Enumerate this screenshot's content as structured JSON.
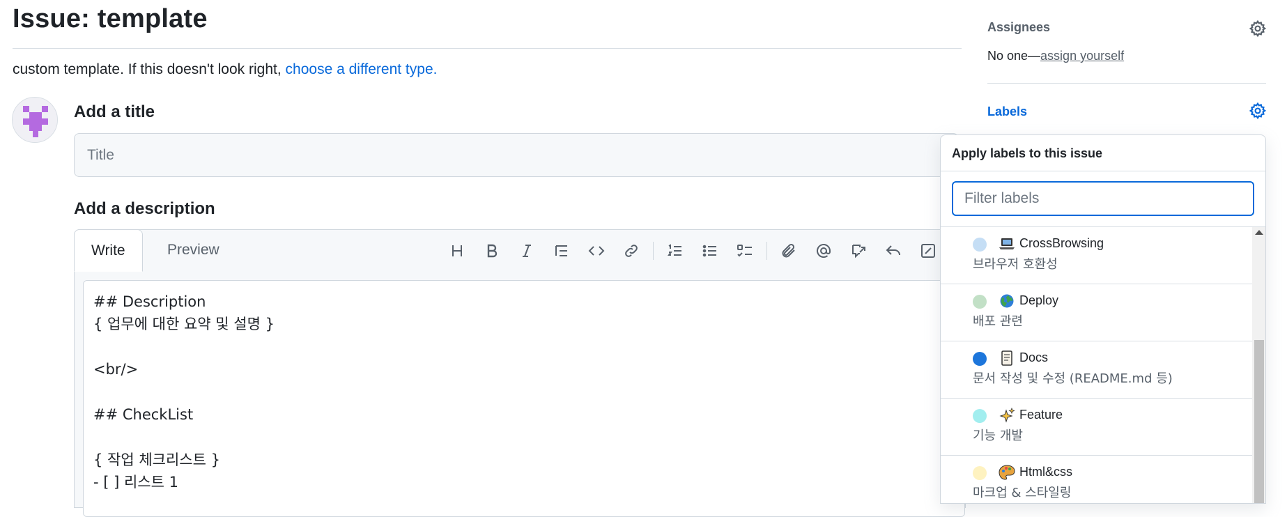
{
  "page": {
    "title": "Issue: template",
    "template_note_prefix": "custom template. If this doesn't look right, ",
    "template_note_link": "choose a different type."
  },
  "form": {
    "title_label": "Add a title",
    "title_placeholder": "Title",
    "description_label": "Add a description",
    "tabs": [
      {
        "label": "Write",
        "active": true
      },
      {
        "label": "Preview",
        "active": false
      }
    ],
    "toolbar_icons": [
      "heading-icon",
      "bold-icon",
      "italic-icon",
      "quote-icon",
      "code-icon",
      "link-icon",
      "numbered-list-icon",
      "bulleted-list-icon",
      "task-list-icon",
      "attach-icon",
      "mention-icon",
      "reference-icon",
      "reply-icon",
      "fullscreen-icon"
    ],
    "body_text": "## Description\n{ 업무에 대한 요약 및 설명 }\n\n<br/>\n\n## CheckList\n\n{ 작업 체크리스트 }\n- [ ] 리스트 1"
  },
  "sidebar": {
    "assignees": {
      "heading": "Assignees",
      "value_prefix": "No one—",
      "assign_link": "assign yourself"
    },
    "labels": {
      "heading": "Labels",
      "popover_title": "Apply labels to this issue",
      "filter_placeholder": "Filter labels",
      "items": [
        {
          "name": "CrossBrowsing",
          "description": "브라우저 호환성",
          "color": "#c5def5",
          "emoji": "laptop-icon"
        },
        {
          "name": "Deploy",
          "description": "배포 관련",
          "color": "#c2e0c6",
          "emoji": "globe-icon"
        },
        {
          "name": "Docs",
          "description": "문서 작성 및 수정 (README.md 등)",
          "color": "#1d76db",
          "emoji": "scroll-icon"
        },
        {
          "name": "Feature",
          "description": "기능 개발",
          "color": "#a2eeef",
          "emoji": "sparkles-icon"
        },
        {
          "name": "Html&css",
          "description": "마크업 & 스타일링",
          "color": "#fef2c0",
          "emoji": "palette-icon"
        }
      ]
    }
  },
  "colors": {
    "accent": "#0969da",
    "border": "#d0d7de",
    "text": "#1f2328",
    "muted": "#57606a"
  }
}
